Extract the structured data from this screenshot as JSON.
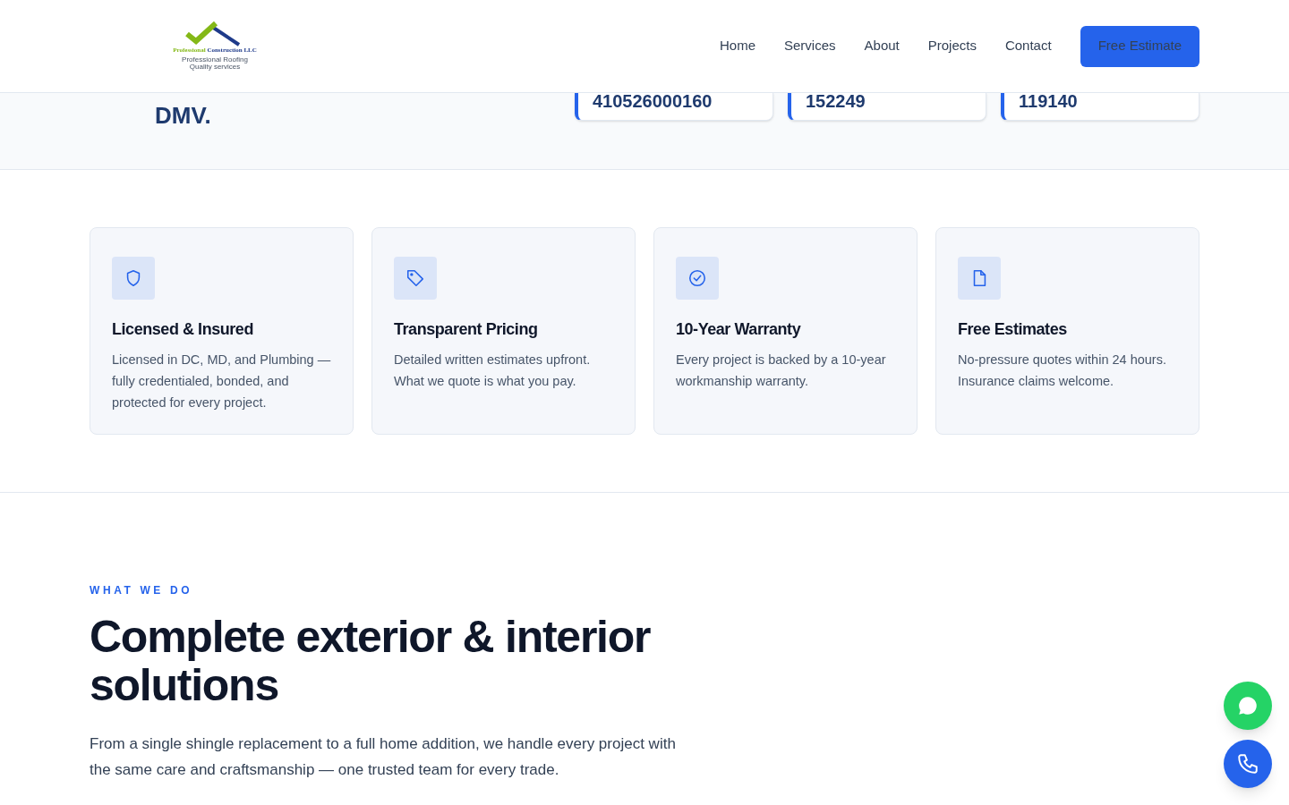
{
  "logo": {
    "name_part1": "Professional",
    "name_part2": "Construction LLC",
    "tagline_1": "Professional Roofing",
    "tagline_2": "Quality services"
  },
  "nav": {
    "links": [
      "Home",
      "Services",
      "About",
      "Projects",
      "Contact"
    ],
    "cta": "Free Estimate"
  },
  "hero_band": {
    "heading_tail": "DMV.",
    "stats": [
      "410526000160",
      "152249",
      "119140"
    ]
  },
  "features": [
    {
      "kind": "shield",
      "title": "Licensed & Insured",
      "text": "Licensed in DC, MD, and Plumbing — fully credentialed, bonded, and protected for every project."
    },
    {
      "kind": "tag",
      "title": "Transparent Pricing",
      "text": "Detailed written estimates upfront. What we quote is what you pay."
    },
    {
      "kind": "check-circle",
      "title": "10-Year Warranty",
      "text": "Every project is backed by a 10-year workmanship warranty."
    },
    {
      "kind": "document",
      "title": "Free Estimates",
      "text": "No-pressure quotes within 24 hours. Insurance claims welcome."
    }
  ],
  "services_intro": {
    "eyebrow": "WHAT WE DO",
    "heading": "Complete exterior & interior solutions",
    "text": "From a single shingle replacement to a full home addition, we handle every project with the same care and craftsmanship — one trusted team for every trade."
  },
  "floating_buttons": [
    {
      "kind": "chat"
    },
    {
      "kind": "phone"
    }
  ]
}
